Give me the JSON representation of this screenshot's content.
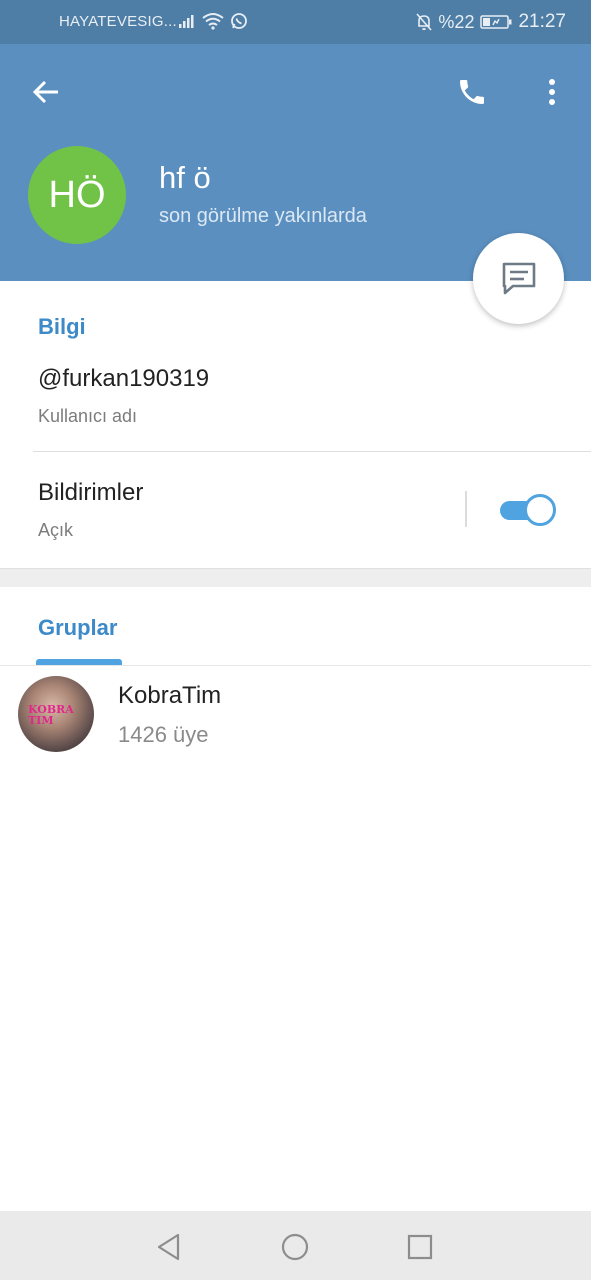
{
  "status_bar": {
    "carrier": "HAYATEVESIG...",
    "battery": "%22",
    "time": "21:27"
  },
  "profile": {
    "avatar_initials": "HÖ",
    "name": "hf ö",
    "status": "son görülme yakınlarda"
  },
  "info": {
    "header": "Bilgi",
    "username": "@furkan190319",
    "username_label": "Kullanıcı adı",
    "notifications_title": "Bildirimler",
    "notifications_value": "Açık",
    "notifications_enabled": true
  },
  "groups": {
    "tab_label": "Gruplar",
    "items": [
      {
        "name": "KobraTim",
        "members": "1426 üye",
        "avatar_text": "KOBRA TIM"
      }
    ]
  },
  "colors": {
    "header": "#5b8fbf",
    "status_bar": "#4e7ea6",
    "accent": "#3d8ac9",
    "avatar": "#71c348"
  },
  "icons": {
    "back": "arrow-left-icon",
    "call": "phone-icon",
    "more": "more-vertical-icon",
    "message": "message-icon"
  }
}
